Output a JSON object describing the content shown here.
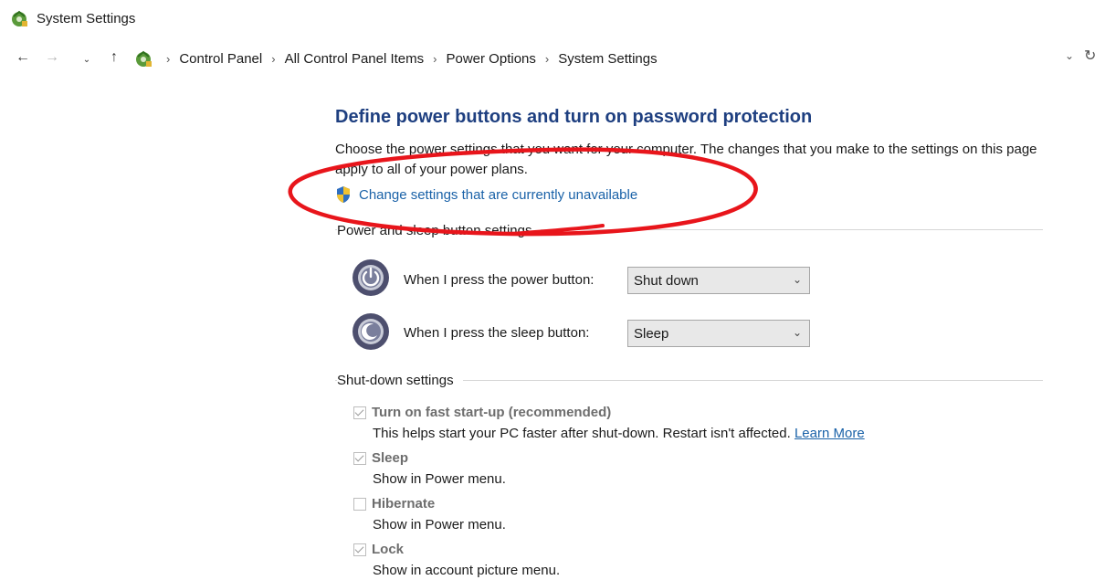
{
  "window": {
    "title": "System Settings"
  },
  "nav": {
    "back_icon": "back-arrow-icon",
    "forward_icon": "forward-arrow-icon",
    "up_icon": "up-arrow-icon",
    "breadcrumbs": [
      "Control Panel",
      "All Control Panel Items",
      "Power Options",
      "System Settings"
    ]
  },
  "main": {
    "heading": "Define power buttons and turn on password protection",
    "description": "Choose the power settings that you want for your computer. The changes that you make to the settings on this page apply to all of your power plans.",
    "change_link": "Change settings that are currently unavailable"
  },
  "power_sleep": {
    "section_label": "Power and sleep button settings",
    "power_button": {
      "label": "When I press the power button:",
      "value": "Shut down"
    },
    "sleep_button": {
      "label": "When I press the sleep button:",
      "value": "Sleep"
    }
  },
  "shutdown": {
    "section_label": "Shut-down settings",
    "items": [
      {
        "label": "Turn on fast start-up (recommended)",
        "checked": true,
        "desc": "This helps start your PC faster after shut-down. Restart isn't affected.",
        "link": "Learn More"
      },
      {
        "label": "Sleep",
        "checked": true,
        "desc": "Show in Power menu."
      },
      {
        "label": "Hibernate",
        "checked": false,
        "desc": "Show in Power menu."
      },
      {
        "label": "Lock",
        "checked": true,
        "desc": "Show in account picture menu."
      }
    ]
  },
  "colors": {
    "heading": "#1e3f80",
    "link": "#1a62a8",
    "annotation": "#e8151b"
  }
}
